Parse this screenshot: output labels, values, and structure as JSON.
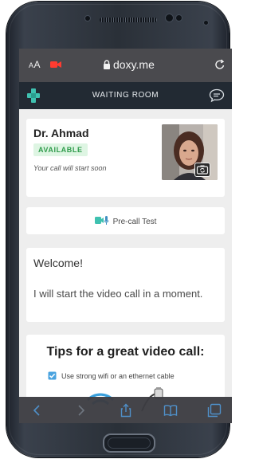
{
  "browser": {
    "text_size_label": "AA",
    "url": "doxy.me",
    "accent_color": "#ff3b30"
  },
  "navbar": {
    "title": "WAITING ROOM",
    "logo_color": "#3fc1b0",
    "icons": [
      "doxy-logo-icon",
      "chat-icon"
    ]
  },
  "provider_card": {
    "doctor_name": "Dr. Ahmad",
    "status_badge": "AVAILABLE",
    "status_color": "#2f9b4b",
    "wait_message": "Your call will start soon"
  },
  "precall": {
    "label": "Pre-call Test",
    "icon": "camera-mic-icon"
  },
  "welcome": {
    "title": "Welcome!",
    "message": "I will start the video call in a moment."
  },
  "tips": {
    "title": "Tips for a great video call:",
    "items": [
      {
        "label": "Use strong wifi or an ethernet cable",
        "checked": true
      }
    ]
  },
  "toolbar": {
    "icons": [
      "back-icon",
      "forward-icon",
      "share-icon",
      "bookmarks-icon",
      "tabs-icon"
    ]
  }
}
